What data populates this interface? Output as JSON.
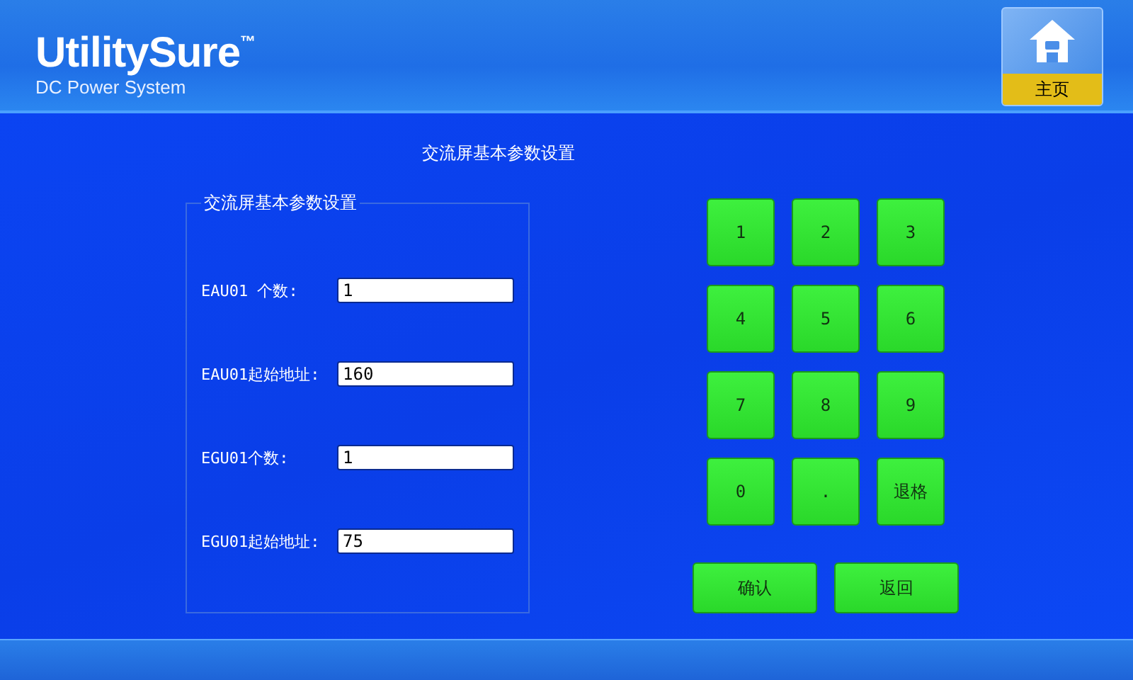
{
  "header": {
    "logo": "UtilitySure$^{™}$",
    "subtitle": "DC Power System",
    "home_button": "主页"
  },
  "page_title": "交流屏基本参数设置",
  "panel": {
    "title": "交流屏基本参数设置",
    "fields": [
      {
        "label": "EAU01 个数:",
        "value": "1"
      },
      {
        "label": "EAU01起始地址:",
        "value": "160"
      },
      {
        "label": "EGU01个数:",
        "value": "1"
      },
      {
        "label": "EGU01起始地址:",
        "value": "75"
      }
    ]
  },
  "keypad": {
    "keys": [
      "1",
      "2",
      "3",
      "4",
      "5",
      "6",
      "7",
      "8",
      "9",
      "0",
      ".",
      "退格"
    ],
    "actions": [
      "确认",
      "返回"
    ]
  }
}
